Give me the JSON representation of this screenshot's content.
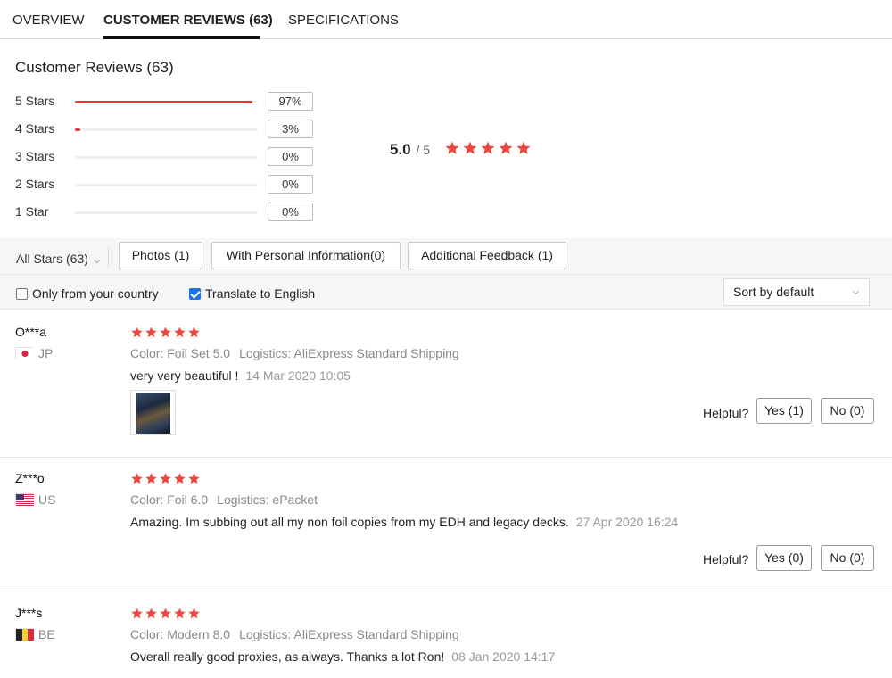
{
  "tabs": [
    {
      "label": "OVERVIEW",
      "active": false
    },
    {
      "label": "CUSTOMER REVIEWS (63)",
      "active": true
    },
    {
      "label": "SPECIFICATIONS",
      "active": false
    }
  ],
  "summary": {
    "title": "Customer Reviews (63)",
    "rows": [
      {
        "label": "5 Stars",
        "percent_label": "97%",
        "fill": 0.97
      },
      {
        "label": "4 Stars",
        "percent_label": "3%",
        "fill": 0.03
      },
      {
        "label": "3 Stars",
        "percent_label": "0%",
        "fill": 0
      },
      {
        "label": "2 Stars",
        "percent_label": "0%",
        "fill": 0
      },
      {
        "label": "1 Star",
        "percent_label": "0%",
        "fill": 0
      }
    ],
    "average": "5.0",
    "out_of": "/ 5",
    "average_stars": 5
  },
  "filters": {
    "all_stars_label": "All Stars (63)",
    "buttons": [
      "Photos (1)",
      "With Personal Information(0)",
      "Additional Feedback (1)"
    ],
    "only_country_label": "Only from your country",
    "only_country_checked": false,
    "translate_label": "Translate to English",
    "translate_checked": true,
    "sort_label": "Sort by default"
  },
  "reviews": [
    {
      "name": "O***a",
      "country": "JP",
      "flag": "flag-jp-icon",
      "stars": 5,
      "color": "Color: Foil Set 5.0",
      "logistics": "Logistics: AliExpress Standard Shipping",
      "text": "very very beautiful !",
      "date": "14 Mar 2020 10:05",
      "has_photo": true,
      "helpful_label": "Helpful?",
      "yes_label": "Yes (1)",
      "no_label": "No (0)"
    },
    {
      "name": "Z***o",
      "country": "US",
      "flag": "flag-us-icon",
      "stars": 5,
      "color": "Color: Foil 6.0",
      "logistics": "Logistics: ePacket",
      "text": "Amazing. Im subbing out all my non foil copies from my EDH and legacy decks.",
      "date": "27 Apr 2020 16:24",
      "has_photo": false,
      "helpful_label": "Helpful?",
      "yes_label": "Yes (0)",
      "no_label": "No (0)"
    },
    {
      "name": "J***s",
      "country": "BE",
      "flag": "flag-be-icon",
      "stars": 5,
      "color": "Color: Modern 8.0",
      "logistics": "Logistics: AliExpress Standard Shipping",
      "text": "Overall really good proxies, as always. Thanks a lot Ron!",
      "date": "08 Jan 2020 14:17",
      "has_photo": false
    }
  ],
  "colors": {
    "accent_red": "#e4393c",
    "star": "#e84a3f",
    "checkbox_blue": "#1a73e8"
  }
}
